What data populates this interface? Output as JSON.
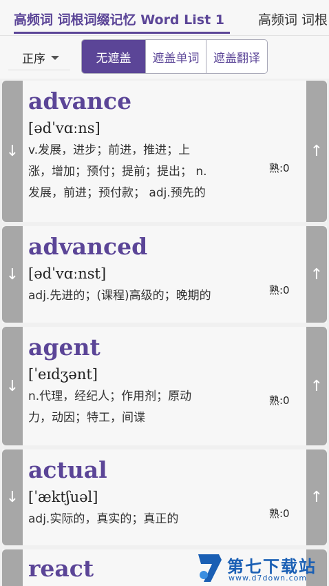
{
  "tabs": {
    "active": "高频词 词根词缀记忆 Word List 1",
    "next": "高频词 词根"
  },
  "toolbar": {
    "order_label": "正序",
    "seg": [
      "无遮盖",
      "遮盖单词",
      "遮盖翻译"
    ],
    "seg_selected": 0
  },
  "cards": [
    {
      "word": "advance",
      "phonetic": "[ədˈvɑːns]",
      "def_lines": [
        "v.发展，进步；前进，推进；上",
        "涨，增加；预付；提前；提出； n.",
        "发展，前进；预付款； adj.预先的"
      ],
      "shu": "熟:0"
    },
    {
      "word": "advanced",
      "phonetic": "[ədˈvɑːnst]",
      "def_lines": [
        "adj.先进的；(课程)高级的；晚期的"
      ],
      "shu": "熟:0"
    },
    {
      "word": "agent",
      "phonetic": "[ˈeɪdʒənt]",
      "def_lines": [
        "n.代理，经纪人；作用剂；原动",
        "力，动因；特工，间谍"
      ],
      "shu": "熟:0"
    },
    {
      "word": "actual",
      "phonetic": "[ˈæktʃuəl]",
      "def_lines": [
        "adj.实际的，真实的；真正的"
      ],
      "shu": "熟:0"
    },
    {
      "word": "react",
      "phonetic": "",
      "def_lines": [],
      "shu": ""
    }
  ],
  "icons": {
    "down": "↓",
    "up": "↑"
  },
  "watermark": {
    "title": "第七下载站",
    "url": "www.d7down.com"
  },
  "colors": {
    "accent": "#5b4597",
    "side": "#a7a7a7"
  }
}
